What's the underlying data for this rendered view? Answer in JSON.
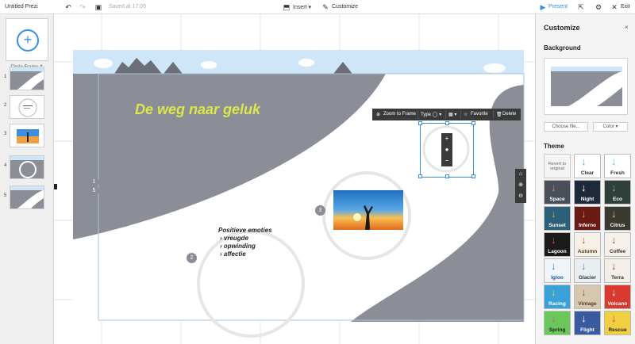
{
  "topbar": {
    "title": "Untitled Prezi",
    "saved": "Saved at 17:05",
    "insert": "Insert",
    "customize": "Customize",
    "present": "Present",
    "exit": "Exit",
    "undo_icon": "undo-icon",
    "redo_icon": "redo-icon",
    "save_icon": "save-icon",
    "share_icon": "share-icon",
    "settings_icon": "gear-icon"
  },
  "sidebar": {
    "frame_type": "Circle Frame",
    "frame_type_caret": "⇕",
    "thumbs": [
      {
        "num": "1"
      },
      {
        "num": "2"
      },
      {
        "num": "3"
      },
      {
        "num": "4"
      },
      {
        "num": "5"
      }
    ]
  },
  "canvas": {
    "title": "De weg naar geluk",
    "emotions_heading": "Positieve emoties",
    "emotions": [
      "vreugde",
      "opwinding",
      "affectie"
    ],
    "badges": [
      "1",
      "5",
      "2",
      "3"
    ]
  },
  "frame_toolbar": {
    "zoom_to_frame": "Zoom to Frame",
    "type": "Type",
    "favorite": "Favorite",
    "delete": "Delete"
  },
  "panel": {
    "title": "Customize",
    "background": "Background",
    "choose_file": "Choose file...",
    "color": "Color",
    "theme": "Theme",
    "reset": "Revert to original",
    "themes": [
      {
        "name": "Clear",
        "bg": "#ffffff",
        "fg": "#333333",
        "arrow": "#6aa8d8"
      },
      {
        "name": "Fresh",
        "bg": "#ffffff",
        "fg": "#333333",
        "arrow": "#5ac8a8"
      },
      {
        "name": "Space",
        "bg": "#4a4f5c",
        "fg": "#ffffff",
        "arrow": "#e08a4a"
      },
      {
        "name": "Night",
        "bg": "#1e2a3a",
        "fg": "#ffffff",
        "arrow": "#ffffff"
      },
      {
        "name": "Eco",
        "bg": "#2f3f3a",
        "fg": "#ffffff",
        "arrow": "#7ac05a"
      },
      {
        "name": "Sunset",
        "bg": "#2c5f7a",
        "fg": "#ffffff",
        "arrow": "#f0a040"
      },
      {
        "name": "Inferno",
        "bg": "#6a1a14",
        "fg": "#ffffff",
        "arrow": "#ff8a2a"
      },
      {
        "name": "Citrus",
        "bg": "#3a3a30",
        "fg": "#ffffff",
        "arrow": "#d8d84a"
      },
      {
        "name": "Lagoon",
        "bg": "#1a1a1a",
        "fg": "#ffffff",
        "arrow": "#e04a4a"
      },
      {
        "name": "Autumn",
        "bg": "#f6f0e6",
        "fg": "#5a3a20",
        "arrow": "#c05a3a"
      },
      {
        "name": "Coffee",
        "bg": "#f5f0ea",
        "fg": "#333333",
        "arrow": "#7a5a40"
      },
      {
        "name": "Igloo",
        "bg": "#eef4fa",
        "fg": "#2a5a8a",
        "arrow": "#3a7ac0"
      },
      {
        "name": "Glacier",
        "bg": "#e8eef2",
        "fg": "#333333",
        "arrow": "#5a8ab0"
      },
      {
        "name": "Terra",
        "bg": "#f3eee8",
        "fg": "#333333",
        "arrow": "#a0403a"
      },
      {
        "name": "Racing",
        "bg": "#3aa0d8",
        "fg": "#ffffff",
        "arrow": "#f0d040"
      },
      {
        "name": "Vintage",
        "bg": "#d6c8b0",
        "fg": "#5a3a20",
        "arrow": "#8a5a30"
      },
      {
        "name": "Volcano",
        "bg": "#d83a30",
        "fg": "#ffffff",
        "arrow": "#ffffff"
      },
      {
        "name": "Spring",
        "bg": "#6ac85a",
        "fg": "#222222",
        "arrow": "#e84a8a"
      },
      {
        "name": "Flight",
        "bg": "#3a5aa0",
        "fg": "#ffffff",
        "arrow": "#ffffff"
      },
      {
        "name": "Rescue",
        "bg": "#f0d040",
        "fg": "#222222",
        "arrow": "#d83a30"
      }
    ]
  },
  "colors": {
    "accent": "#3a8fe0",
    "road_grey": "#8b8e97",
    "sky": "#cfe6f8",
    "title_yellow": "#dde64a"
  }
}
